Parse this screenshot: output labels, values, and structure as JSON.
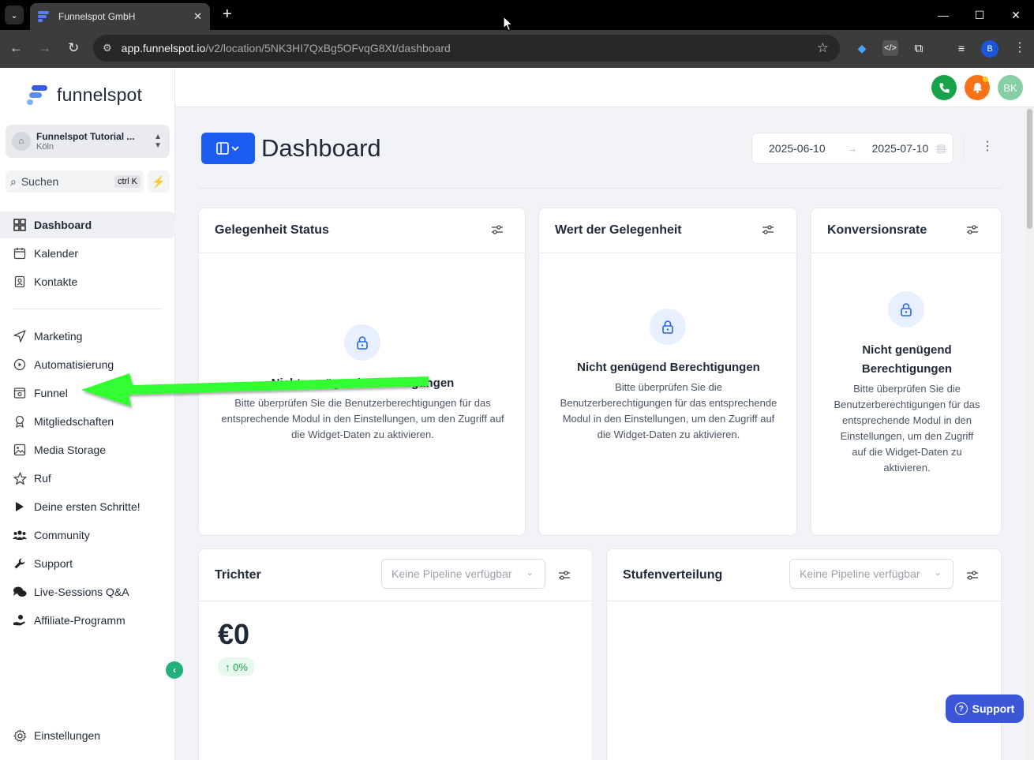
{
  "browser": {
    "tab_title": "Funnelspot GmbH",
    "url_host": "app.funnelspot.io",
    "url_path": "/v2/location/5NK3HI7QxBg5OFvqG8Xt/dashboard",
    "profile_initial": "B"
  },
  "sidebar": {
    "logo_text": "funnelspot",
    "location": {
      "name": "Funnelspot Tutorial ...",
      "city": "Köln"
    },
    "search": {
      "label": "Suchen",
      "shortcut": "ctrl K"
    },
    "items": [
      {
        "label": "Dashboard",
        "icon": "dashboard-icon",
        "active": true
      },
      {
        "label": "Kalender",
        "icon": "calendar-icon"
      },
      {
        "label": "Kontakte",
        "icon": "contacts-icon"
      },
      {
        "label": "Marketing",
        "icon": "send-icon"
      },
      {
        "label": "Automatisierung",
        "icon": "automation-icon"
      },
      {
        "label": "Funnel",
        "icon": "funnel-icon"
      },
      {
        "label": "Mitgliedschaften",
        "icon": "membership-icon"
      },
      {
        "label": "Media Storage",
        "icon": "image-icon"
      },
      {
        "label": "Ruf",
        "icon": "star-icon"
      },
      {
        "label": "Deine ersten Schritte!",
        "icon": "play-icon"
      },
      {
        "label": "Community",
        "icon": "users-icon"
      },
      {
        "label": "Support",
        "icon": "wrench-icon"
      },
      {
        "label": "Live-Sessions Q&A",
        "icon": "chat-icon"
      },
      {
        "label": "Affiliate-Programm",
        "icon": "hand-money-icon"
      }
    ],
    "settings_label": "Einstellungen"
  },
  "header": {
    "avatar_initials": "BK",
    "colors": {
      "phone": "#16a34a",
      "bell": "#f97316",
      "avatar": "#86cfa3"
    }
  },
  "main": {
    "title": "Dashboard",
    "date_from": "2025-06-10",
    "date_to": "2025-07-10",
    "cards": {
      "status": {
        "title": "Gelegenheit Status",
        "perm_title": "Nicht genügend Berechtigungen",
        "perm_text": "Bitte überprüfen Sie die Benutzerberechtigungen für das entsprechende Modul in den Einstellungen, um den Zugriff auf die Widget-Daten zu aktivieren."
      },
      "value": {
        "title": "Wert der Gelegenheit",
        "perm_title": "Nicht genügend Berechtigungen",
        "perm_text": "Bitte überprüfen Sie die Benutzerberechtigungen für das entsprechende Modul in den Einstellungen, um den Zugriff auf die Widget-Daten zu aktivieren."
      },
      "conversion": {
        "title": "Konversionsrate",
        "perm_title": "Nicht genügend Berechtigungen",
        "perm_text": "Bitte überprüfen Sie die Benutzerberechtigungen für das entsprechende Modul in den Einstellungen, um den Zugriff auf die Widget-Daten zu aktivieren."
      },
      "funnel": {
        "title": "Trichter",
        "pipeline_placeholder": "Keine Pipeline verfügbar",
        "value": "€0",
        "change": "↑ 0%"
      },
      "stages": {
        "title": "Stufenverteilung",
        "pipeline_placeholder": "Keine Pipeline verfügbar"
      }
    }
  },
  "support_button": "Support",
  "accent_color": "#1d5cf0",
  "annotation_arrow_color": "#33ff33"
}
